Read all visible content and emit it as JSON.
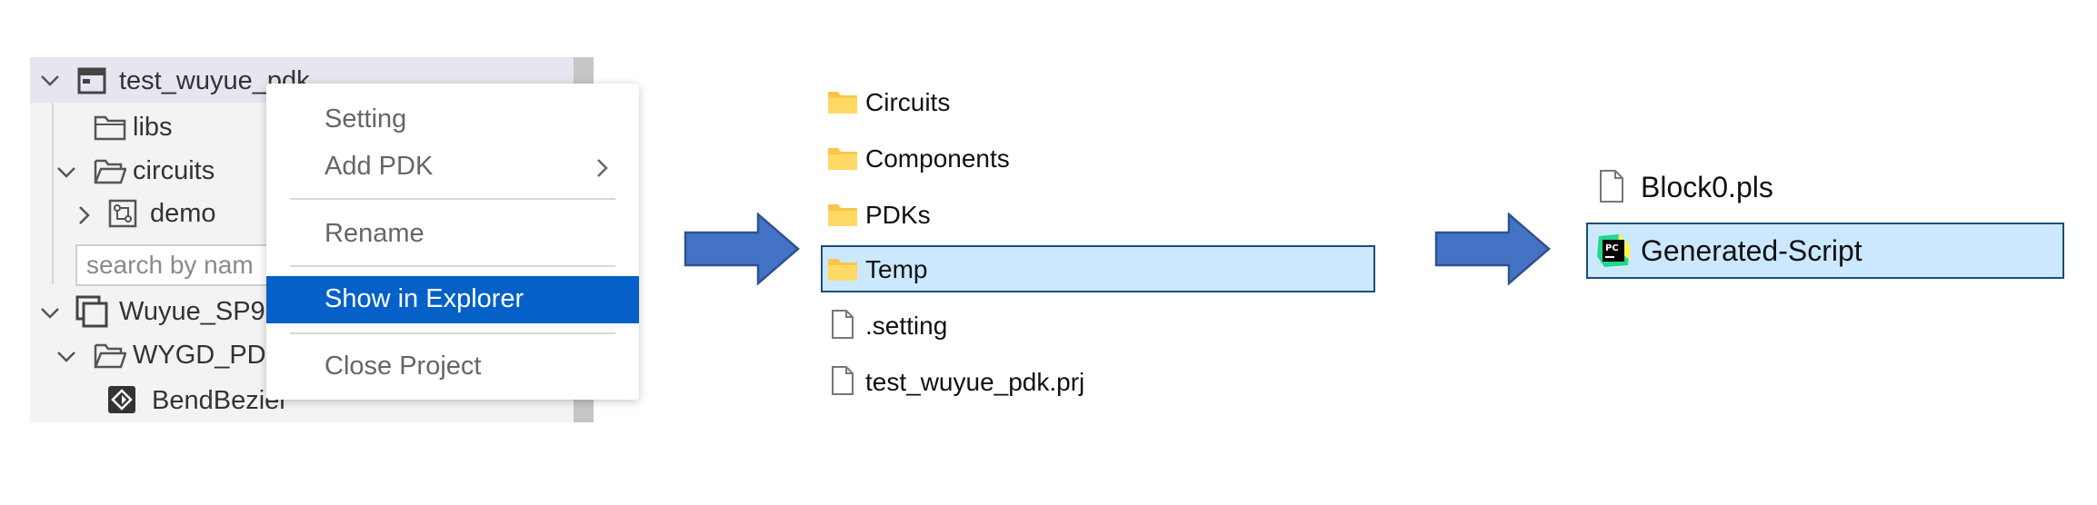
{
  "tree": {
    "items": [
      {
        "label": "test_wuyue_pdk",
        "icon": "project-window-icon",
        "expander": "chevron-down-icon"
      },
      {
        "label": "libs",
        "icon": "folder-icon"
      },
      {
        "label": "circuits",
        "icon": "folder-open-icon",
        "expander": "chevron-down-icon"
      },
      {
        "label": "demo",
        "icon": "circuit-schematic-icon",
        "expander": "chevron-right-icon"
      },
      {
        "label": "Wuyue_SP9",
        "icon": "library-stack-icon",
        "expander": "chevron-down-icon"
      },
      {
        "label": "WYGD_PD",
        "icon": "folder-open-icon",
        "expander": "chevron-down-icon"
      },
      {
        "label": "BendBezier",
        "icon": "component-diamond-icon"
      }
    ],
    "search_placeholder": "search by nam"
  },
  "context_menu": {
    "items": [
      {
        "label": "Setting"
      },
      {
        "label": "Add PDK",
        "submenu": true
      },
      {
        "label": "Rename"
      },
      {
        "label": "Show in Explorer",
        "selected": true
      },
      {
        "label": "Close Project"
      }
    ]
  },
  "explorer": {
    "items": [
      {
        "label": "Circuits",
        "icon": "folder-icon"
      },
      {
        "label": "Components",
        "icon": "folder-icon"
      },
      {
        "label": "PDKs",
        "icon": "folder-icon"
      },
      {
        "label": "Temp",
        "icon": "folder-icon",
        "selected": true
      },
      {
        "label": ".setting",
        "icon": "file-icon"
      },
      {
        "label": "test_wuyue_pdk.prj",
        "icon": "file-icon"
      }
    ]
  },
  "temp_contents": {
    "items": [
      {
        "label": "Block0.pls",
        "icon": "file-icon"
      },
      {
        "label": "Generated-Script",
        "icon": "pycharm-icon",
        "selected": true
      }
    ]
  },
  "colors": {
    "menu_selected": "#0560c8",
    "selection_fill": "#cce8ff",
    "arrow_fill": "#4472c4",
    "folder_yellow": "#f8c64a"
  }
}
